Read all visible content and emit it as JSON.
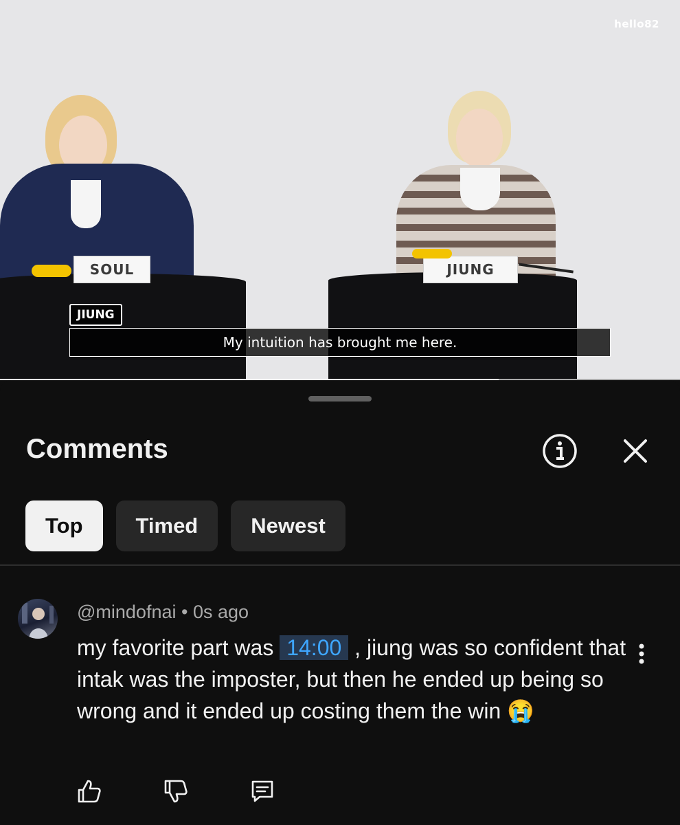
{
  "video": {
    "watermark": "hello82",
    "nameplate_left": "SOUL",
    "nameplate_right": "JIUNG",
    "speaker_tag": "JIUNG",
    "subtitle": "My intuition has brought me here.",
    "progress_fraction": 0.733
  },
  "comments_panel": {
    "title": "Comments",
    "info_icon": "info-circle-icon",
    "close_icon": "close-icon",
    "sort_chips": [
      {
        "label": "Top",
        "active": true
      },
      {
        "label": "Timed",
        "active": false
      },
      {
        "label": "Newest",
        "active": false
      }
    ]
  },
  "comment": {
    "author": "@mindofnai",
    "separator": "•",
    "time": "0s ago",
    "text_before": "my favorite part was ",
    "timestamp": "14:00",
    "text_after": " , jiung was so confident that intak was the imposter, but then he ended up being so wrong and it ended up costing them the win",
    "emoji": "😭",
    "more_icon": "more-vertical-icon",
    "actions": [
      "like-icon",
      "dislike-icon",
      "reply-icon"
    ]
  },
  "colors": {
    "background": "#0f0f0f",
    "chip_active": "#f1f1f1",
    "chip_inactive": "#272727",
    "timestamp_link": "#3ea6ff",
    "timestamp_bg": "#263850"
  }
}
